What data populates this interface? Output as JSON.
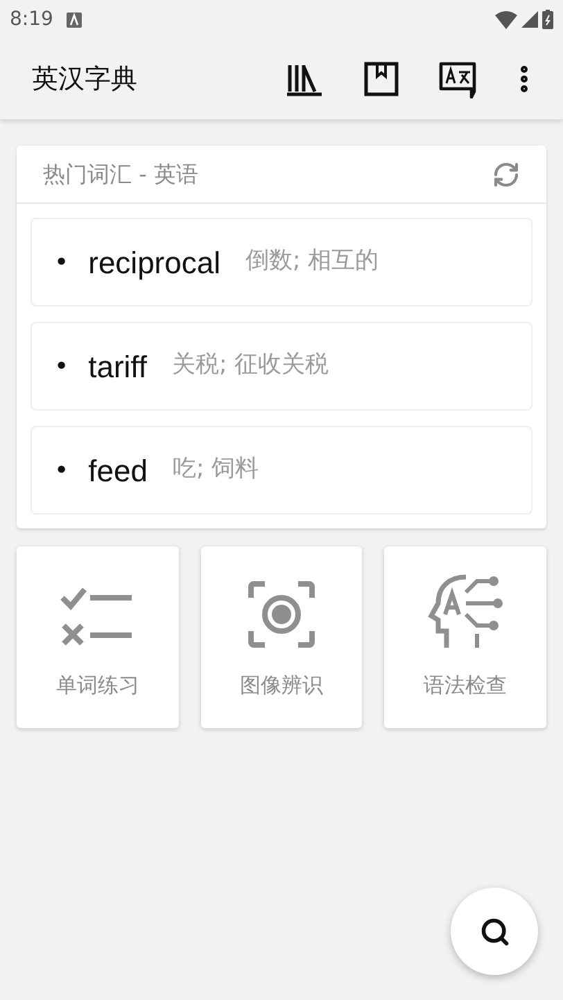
{
  "status_bar": {
    "time": "8:19"
  },
  "app_bar": {
    "title": "英汉字典"
  },
  "hot_words": {
    "title": "热门词汇 - 英语",
    "words": [
      {
        "bullet": "•",
        "word": "reciprocal",
        "meaning": "倒数; 相互的"
      },
      {
        "bullet": "•",
        "word": "tariff",
        "meaning": "关税; 征收关税"
      },
      {
        "bullet": "•",
        "word": "feed",
        "meaning": "吃; 饲料"
      }
    ]
  },
  "tools": [
    {
      "kind": "checklist",
      "label": "单词练习"
    },
    {
      "kind": "camera",
      "label": "图像辨识"
    },
    {
      "kind": "grammar",
      "label": "语法检查"
    }
  ]
}
